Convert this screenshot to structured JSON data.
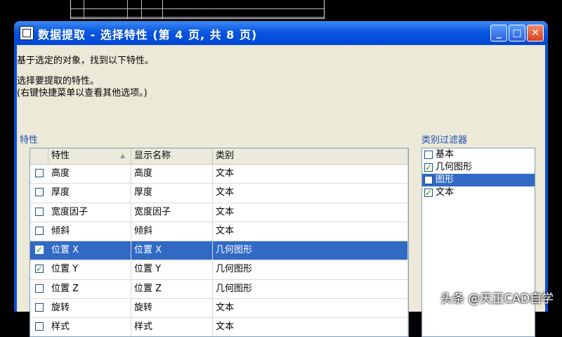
{
  "window": {
    "title": "数据提取 - 选择特性 (第 4 页, 共 8 页)"
  },
  "intro": {
    "line1": "基于选定的对象，找到以下特性。",
    "line2": "选择要提取的特性。",
    "line3": "(右键快捷菜单以查看其他选项。)"
  },
  "properties": {
    "label": "特性",
    "columns": [
      "特性",
      "显示名称",
      "类别"
    ],
    "rows": [
      {
        "checked": false,
        "name": "高度",
        "display": "高度",
        "category": "文本",
        "selected": false
      },
      {
        "checked": false,
        "name": "厚度",
        "display": "厚度",
        "category": "文本",
        "selected": false
      },
      {
        "checked": false,
        "name": "宽度因子",
        "display": "宽度因子",
        "category": "文本",
        "selected": false
      },
      {
        "checked": false,
        "name": "倾斜",
        "display": "倾斜",
        "category": "文本",
        "selected": false
      },
      {
        "checked": true,
        "name": "位置 X",
        "display": "位置 X",
        "category": "几何图形",
        "selected": true
      },
      {
        "checked": true,
        "name": "位置 Y",
        "display": "位置 Y",
        "category": "几何图形",
        "selected": false
      },
      {
        "checked": false,
        "name": "位置 Z",
        "display": "位置 Z",
        "category": "几何图形",
        "selected": false
      },
      {
        "checked": false,
        "name": "旋转",
        "display": "旋转",
        "category": "文本",
        "selected": false
      },
      {
        "checked": false,
        "name": "样式",
        "display": "样式",
        "category": "文本",
        "selected": false
      }
    ]
  },
  "category_filter": {
    "label": "类别过滤器",
    "items": [
      {
        "checked": false,
        "label": "基本",
        "selected": false
      },
      {
        "checked": true,
        "label": "几何图形",
        "selected": false
      },
      {
        "checked": false,
        "label": "图形",
        "selected": true
      },
      {
        "checked": true,
        "label": "文本",
        "selected": false
      }
    ]
  },
  "watermark": "头条 @天正CAD自学",
  "colors": {
    "titlebar": "#0a56e0",
    "selection": "#316ac5",
    "dialog": "#ece9d8"
  },
  "icons": [
    "app-icon",
    "minimize-icon",
    "maximize-icon",
    "close-icon",
    "check-icon",
    "sort-arrow-icon"
  ]
}
